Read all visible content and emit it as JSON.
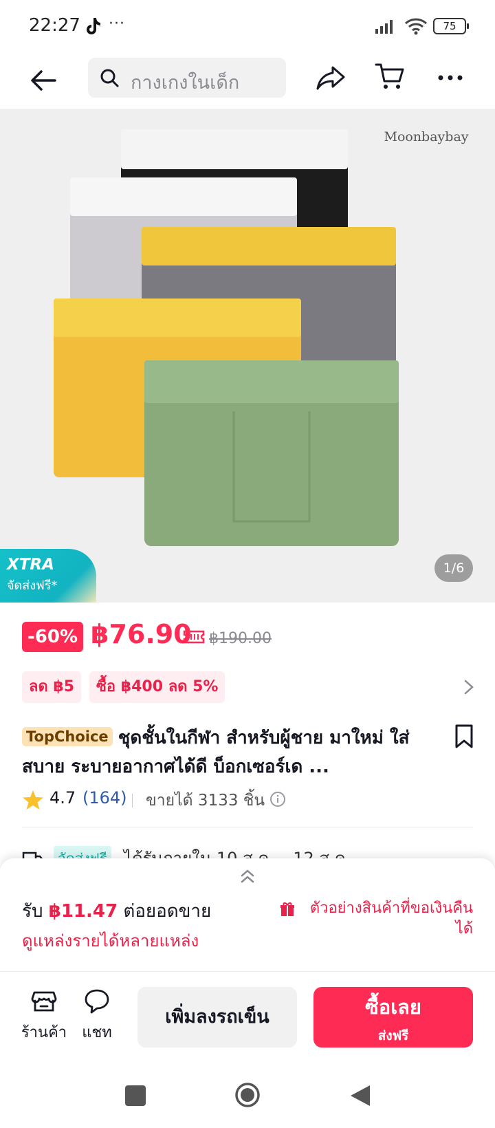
{
  "status_bar": {
    "time": "22:27",
    "dots": "···",
    "battery": "75"
  },
  "nav": {
    "search_placeholder": "กางเกงในเด็ก"
  },
  "hero": {
    "brand_watermark": "Moonbaybay",
    "xtra_title": "XTRA",
    "xtra_subtitle": "จัดส่งฟรี*",
    "image_counter": "1/6"
  },
  "price": {
    "discount": "-60%",
    "current": "฿76.90",
    "original": "฿190.00"
  },
  "promos": [
    {
      "label": "ลด ฿5"
    },
    {
      "label": "ซื้อ ฿400 ลด 5%"
    }
  ],
  "product": {
    "badge": "TopChoice",
    "title": "ชุดชั้นในกีฬา สำหรับผู้ชาย มาใหม่ ใส่สบาย ระบายอากาศได้ดี บ็อกเซอร์เด ..."
  },
  "rating": {
    "score": "4.7",
    "reviews": "(164)",
    "sold": "ขายได้ 3133 ชิ้น"
  },
  "shipping": {
    "badge": "จัดส่งฟรี",
    "text": "ได้รับภายใน 10 ส.ค. – 12 ส.ค."
  },
  "affiliate": {
    "earn_prefix": "รับ ",
    "earn_amount": "฿11.47",
    "earn_suffix": " ต่อยอดขาย",
    "sources_link": "ดูแหล่งรายได้หลายแหล่ง",
    "sample_link": "ตัวอย่างสินค้าที่ขอเงินคืนได้"
  },
  "bottom_bar": {
    "shop_label": "ร้านค้า",
    "chat_label": "แชท",
    "add_to_cart": "เพิ่มลงรถเข็น",
    "buy_now": "ซื้อเลย",
    "buy_sub": "ส่งฟรี"
  },
  "colors": {
    "accent": "#fe2c55",
    "promo_bg": "#ffeef1",
    "topchoice_bg": "#fde2b5",
    "xtra_teal": "#15c1c8"
  }
}
